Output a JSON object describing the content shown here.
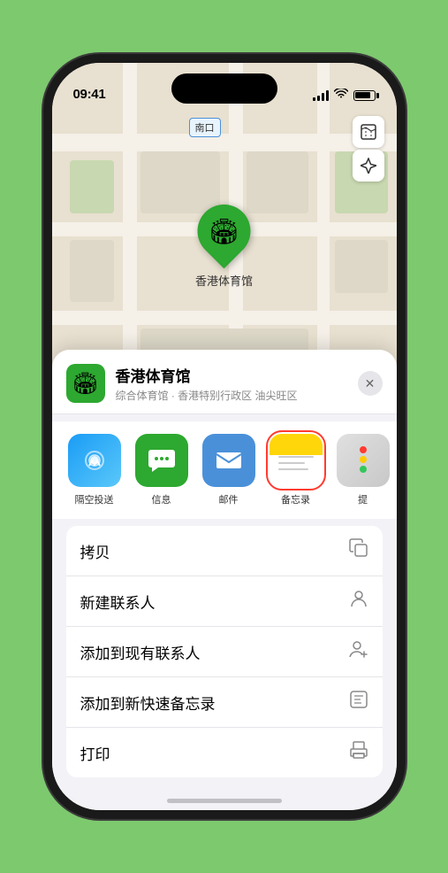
{
  "status_bar": {
    "time": "09:41",
    "location_arrow": "▶"
  },
  "map": {
    "label": "南口",
    "pin_label": "香港体育馆"
  },
  "controls": {
    "map_type": "🗺",
    "location": "⬆"
  },
  "place": {
    "name": "香港体育馆",
    "subtitle": "综合体育馆 · 香港特别行政区 油尖旺区"
  },
  "share_items": [
    {
      "id": "airdrop",
      "label": "隔空投送"
    },
    {
      "id": "message",
      "label": "信息"
    },
    {
      "id": "mail",
      "label": "邮件"
    },
    {
      "id": "notes",
      "label": "备忘录",
      "selected": true
    },
    {
      "id": "more",
      "label": "提"
    }
  ],
  "actions": [
    {
      "label": "拷贝",
      "icon": "copy"
    },
    {
      "label": "新建联系人",
      "icon": "person"
    },
    {
      "label": "添加到现有联系人",
      "icon": "person-add"
    },
    {
      "label": "添加到新快速备忘录",
      "icon": "note"
    },
    {
      "label": "打印",
      "icon": "print"
    }
  ]
}
